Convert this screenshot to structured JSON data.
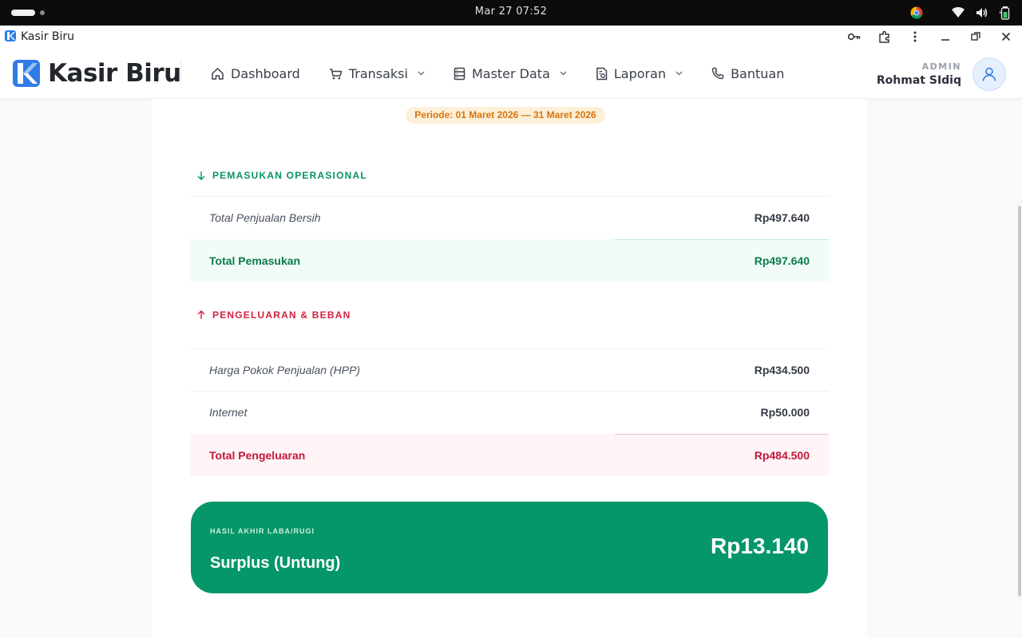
{
  "os": {
    "clock": "Mar 27  07:52",
    "tray_icons": [
      "chrome-icon",
      "wifi-icon",
      "volume-icon",
      "battery-icon"
    ]
  },
  "browser": {
    "tab_title": "Kasir Biru",
    "actions": [
      "key-icon",
      "extensions-icon",
      "menu-icon",
      "minimize-icon",
      "restore-icon",
      "close-icon"
    ]
  },
  "app": {
    "brand": "Kasir Biru",
    "brand_color": "#2f7be8",
    "nav": {
      "dashboard": "Dashboard",
      "transaksi": "Transaksi",
      "master_data": "Master Data",
      "laporan": "Laporan",
      "bantuan": "Bantuan"
    },
    "user": {
      "role": "ADMIN",
      "name": "Rohmat SIdiq"
    }
  },
  "report": {
    "periode": "Periode: 01 Maret 2026 — 31 Maret 2026",
    "income": {
      "heading": "PEMASUKAN OPERASIONAL",
      "rows": [
        {
          "label": "Total Penjualan Bersih",
          "value": "Rp497.640"
        }
      ],
      "total_label": "Total Pemasukan",
      "total_value": "Rp497.640",
      "color": "#07935f"
    },
    "expense": {
      "heading": "PENGELUARAN & BEBAN",
      "rows": [
        {
          "label": "Harga Pokok Penjualan (HPP)",
          "value": "Rp434.500"
        },
        {
          "label": "Internet",
          "value": "Rp50.000"
        }
      ],
      "total_label": "Total Pengeluaran",
      "total_value": "Rp484.500",
      "color": "#d0223f"
    },
    "result": {
      "tag": "HASIL AKHIR LABA/RUGI",
      "status": "Surplus (Untung)",
      "amount": "Rp13.140",
      "color": "#059669"
    }
  }
}
